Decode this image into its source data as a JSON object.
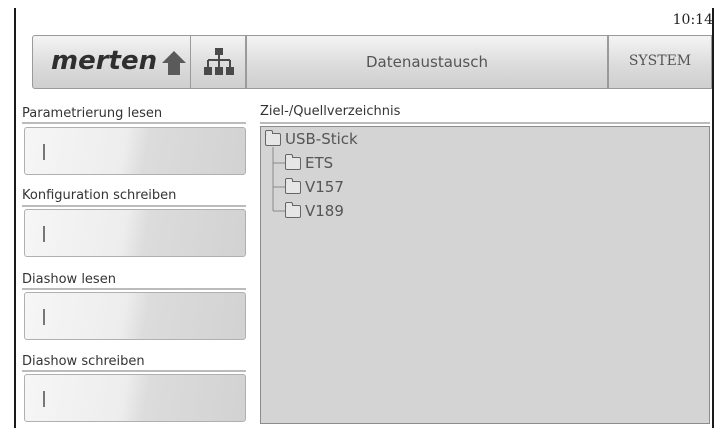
{
  "status": {
    "time": "10:14"
  },
  "header": {
    "logo": "merten",
    "title": "Datenaustausch",
    "system_label": "SYSTEM",
    "home_icon": "house-icon",
    "network_icon": "network-tree-icon"
  },
  "actions": [
    {
      "label": "Parametrierung lesen"
    },
    {
      "label": "Konfiguration schreiben"
    },
    {
      "label": "Diashow lesen"
    },
    {
      "label": "Diashow schreiben"
    }
  ],
  "directory": {
    "label": "Ziel-/Quellverzeichnis",
    "root": "USB-Stick",
    "children": [
      "ETS",
      "V157",
      "V189"
    ]
  }
}
